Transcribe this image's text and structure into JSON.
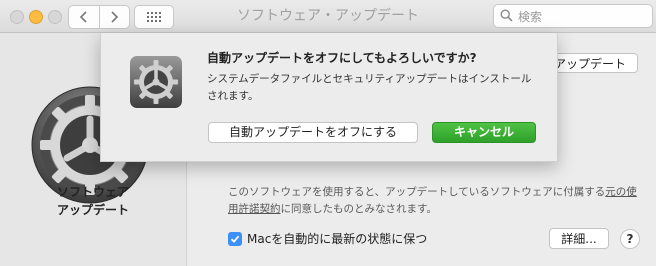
{
  "window": {
    "title": "ソフトウェア・アップデート",
    "search_placeholder": "検索"
  },
  "toolbar": {
    "back_icon": "chevron-left-icon",
    "forward_icon": "chevron-right-icon",
    "grid_icon": "grid-icon"
  },
  "pane": {
    "title_line1": "ソフトウェア",
    "title_line2": "アップデート"
  },
  "content": {
    "update_button_label": "アップデート",
    "terms_text": "このソフトウェアを使用すると、アップデートしているソフトウェアに付属する",
    "terms_link": "元の使用許諾契約",
    "terms_suffix": "に同意したものとみなされます。",
    "auto_update_label": "Macを自動的に最新の状態に保つ",
    "auto_update_checked": true,
    "detail_button_label": "詳細...",
    "help_button_label": "?"
  },
  "dialog": {
    "title": "自動アップデートをオフにしてもよろしいですか?",
    "message": "システムデータファイルとセキュリティアップデートはインストールされます。",
    "turn_off_label": "自動アップデートをオフにする",
    "cancel_label": "キャンセル"
  },
  "colors": {
    "accent_blue": "#3b91f7",
    "cancel_green": "#2ea12a",
    "minimize_yellow": "#fdbc40"
  }
}
